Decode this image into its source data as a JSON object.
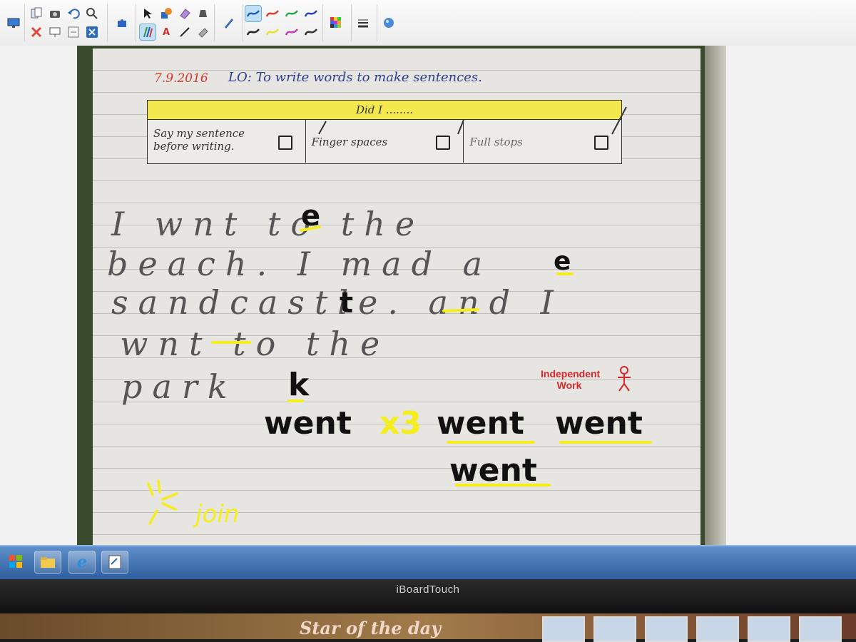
{
  "toolbar": {
    "icons": [
      "display-icon",
      "page-sorter-icon",
      "camera-icon",
      "undo-icon",
      "zoom-icon",
      "puzzle-icon",
      "select-icon",
      "shapes-icon",
      "eraser-icon",
      "fill-icon",
      "delete-icon",
      "screen-icon",
      "redo-icon",
      "close-icon",
      "pen-icon",
      "text-icon",
      "line-icon",
      "highlighter-icon",
      "pen-settings-icon",
      "color-palette-icon",
      "line-style-icon",
      "help-icon"
    ],
    "pen_colors": [
      "#1b5fbf",
      "#e23b2c",
      "#29a84a",
      "#2a45b8",
      "#222222",
      "#ecdf30",
      "#c23bb5",
      "#333333"
    ],
    "text_tool_label": "A"
  },
  "worksheet": {
    "date": "7.9.2016",
    "objective": "LO: To write words to make sentences.",
    "checklist": {
      "header": "Did I ........",
      "items": [
        "Say my sentence before writing.",
        "Finger spaces",
        "Full stops"
      ]
    },
    "handwriting_lines": [
      "I wnt to the",
      "beach. I mad a",
      "sandcastle. and I",
      "wnt to the",
      "park"
    ],
    "corrections": {
      "letters": [
        "e",
        "e",
        "t",
        "k"
      ],
      "practice": "went",
      "multiplier": "x3",
      "practice_words": [
        "went",
        "went",
        "went"
      ],
      "tip": "join"
    },
    "stamp": "Independent Work"
  },
  "taskbar": {
    "icons": [
      "windows-start-icon",
      "file-explorer-icon",
      "internet-explorer-icon",
      "notes-icon"
    ]
  },
  "monitor": {
    "brand": "iBoardTouch"
  },
  "wall_display": {
    "banner": "Star of the day"
  },
  "colors": {
    "toolbar_bg": "#f1f1f1",
    "highlight_yellow": "#f5ee1e",
    "ink_black": "#111111",
    "date_red": "#d23a2a",
    "lo_blue": "#2a3f8f",
    "checklist_yellow": "#f3e84e",
    "stamp_red": "#d8262a",
    "taskbar_blue": "#3f74b8"
  }
}
